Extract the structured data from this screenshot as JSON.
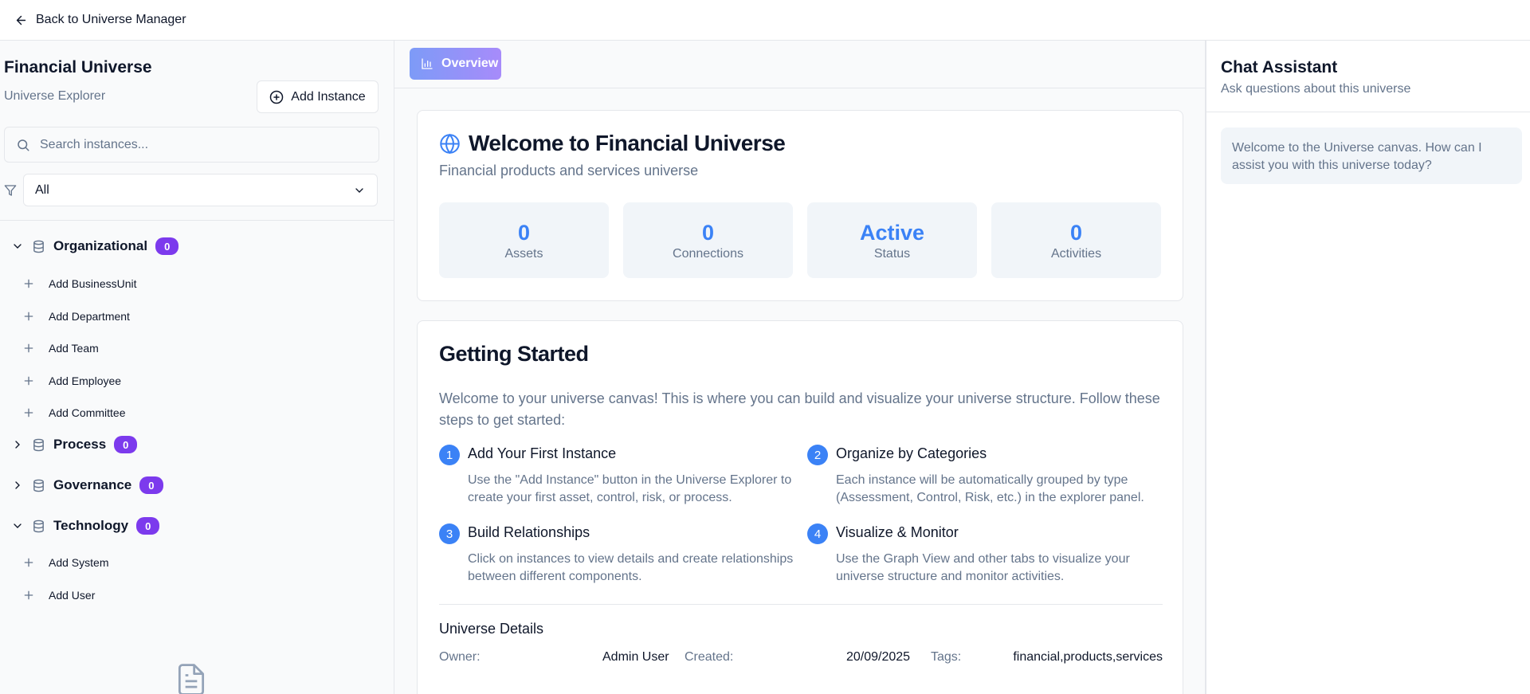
{
  "topbar": {
    "back_label": "Back to Universe Manager"
  },
  "sidebar": {
    "title": "Financial Universe",
    "subtitle": "Universe Explorer",
    "add_instance_label": "Add Instance",
    "search_placeholder": "Search instances...",
    "filter_value": "All",
    "categories": [
      {
        "label": "Organizational",
        "count": "0",
        "expanded": true,
        "items": [
          "Add BusinessUnit",
          "Add Department",
          "Add Team",
          "Add Employee",
          "Add Committee"
        ]
      },
      {
        "label": "Process",
        "count": "0",
        "expanded": false,
        "items": []
      },
      {
        "label": "Governance",
        "count": "0",
        "expanded": false,
        "items": []
      },
      {
        "label": "Technology",
        "count": "0",
        "expanded": true,
        "items": [
          "Add System",
          "Add User"
        ]
      }
    ]
  },
  "main": {
    "tab_overview": "Overview",
    "welcome": {
      "title": "Welcome to Financial Universe",
      "subtitle": "Financial products and services universe",
      "stats": [
        {
          "value": "0",
          "label": "Assets"
        },
        {
          "value": "0",
          "label": "Connections"
        },
        {
          "value": "Active",
          "label": "Status"
        },
        {
          "value": "0",
          "label": "Activities"
        }
      ]
    },
    "getting_started": {
      "title": "Getting Started",
      "intro": "Welcome to your universe canvas! This is where you can build and visualize your universe structure. Follow these steps to get started:",
      "steps": [
        {
          "num": "1",
          "title": "Add Your First Instance",
          "desc": "Use the \"Add Instance\" button in the Universe Explorer to create your first asset, control, risk, or process."
        },
        {
          "num": "2",
          "title": "Organize by Categories",
          "desc": "Each instance will be automatically grouped by type (Assessment, Control, Risk, etc.) in the explorer panel."
        },
        {
          "num": "3",
          "title": "Build Relationships",
          "desc": "Click on instances to view details and create relationships between different components."
        },
        {
          "num": "4",
          "title": "Visualize & Monitor",
          "desc": "Use the Graph View and other tabs to visualize your universe structure and monitor activities."
        }
      ],
      "details": {
        "title": "Universe Details",
        "owner_label": "Owner:",
        "owner": "Admin User",
        "created_label": "Created:",
        "created": "20/09/2025",
        "tags_label": "Tags:",
        "tags": "financial,products,services"
      }
    }
  },
  "chat": {
    "title": "Chat Assistant",
    "subtitle": "Ask questions about this universe",
    "message": "Welcome to the Universe canvas. How can I assist you with this universe today?"
  },
  "colors": {
    "accent": "#3b82f6",
    "badge": "#7c3aed",
    "muted": "#64748b"
  }
}
